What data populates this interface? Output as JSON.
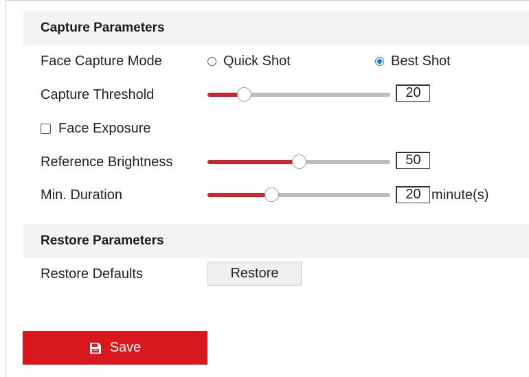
{
  "capture": {
    "header": "Capture Parameters",
    "mode_label": "Face Capture Mode",
    "mode_options": [
      {
        "label": "Quick Shot",
        "checked": false
      },
      {
        "label": "Best Shot",
        "checked": true
      }
    ],
    "threshold_label": "Capture Threshold",
    "threshold_value": "20",
    "threshold_fraction": 0.2,
    "exposure_label": "Face Exposure",
    "exposure_checked": false,
    "brightness_label": "Reference Brightness",
    "brightness_value": "50",
    "brightness_fraction": 0.5,
    "duration_label": "Min. Duration",
    "duration_value": "20",
    "duration_fraction": 0.35,
    "duration_unit": "minute(s)"
  },
  "restore": {
    "header": "Restore Parameters",
    "defaults_label": "Restore Defaults",
    "button_label": "Restore"
  },
  "save": {
    "button_label": "Save",
    "icon": "save-icon"
  },
  "colors": {
    "accent_red": "#d7191f",
    "slider_fill": "#d0232b",
    "radio_blue": "#1a73e8"
  }
}
